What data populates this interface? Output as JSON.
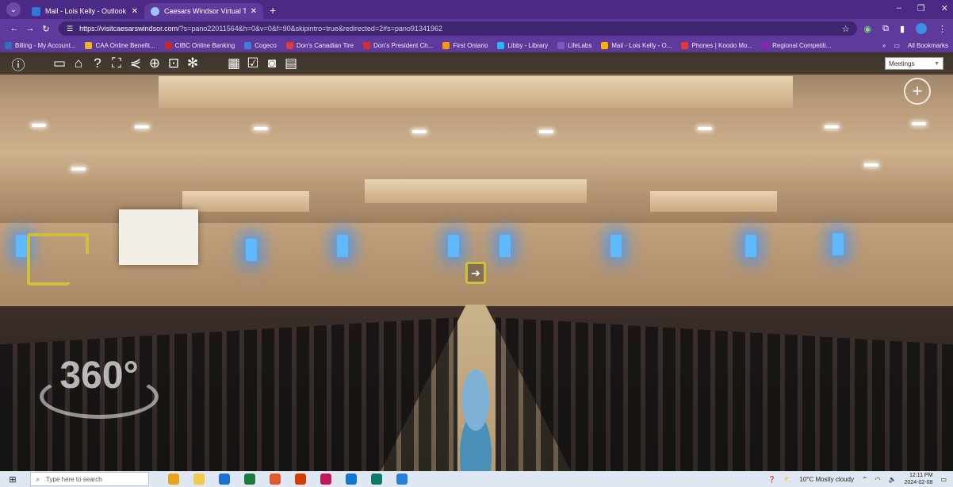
{
  "tabs": [
    {
      "title": "Mail - Lois Kelly - Outlook",
      "color": "#2b7bd8",
      "active": false
    },
    {
      "title": "Caesars Windsor Virtual Tour b",
      "color": "#9cc3f5",
      "active": true
    }
  ],
  "new_tab_symbol": "+",
  "window_controls": {
    "minimize": "–",
    "restore": "❐",
    "close": "✕"
  },
  "address_bar": {
    "domain": "https://visitcaesarswindsor.com",
    "path": "/?s=pano22011564&h=0&v=0&f=90&skipintro=true&redirected=2#s=pano91341962"
  },
  "bookmarks": [
    {
      "label": "Billing - My Account...",
      "color": "#2f6fc2"
    },
    {
      "label": "CAA Online Benefit...",
      "color": "#f0b429"
    },
    {
      "label": "CIBC Online Banking",
      "color": "#c62828"
    },
    {
      "label": "Cogeco",
      "color": "#3f7dd6"
    },
    {
      "label": "Don's Canadian Tire",
      "color": "#e53935"
    },
    {
      "label": "Don's President Ch...",
      "color": "#d32f2f"
    },
    {
      "label": "First Ontario",
      "color": "#ff9800"
    },
    {
      "label": "Libby - Library",
      "color": "#29b6f6"
    },
    {
      "label": "LifeLabs",
      "color": "#7e57c2"
    },
    {
      "label": "Mail - Lois Kelly - O...",
      "color": "#ffb300"
    },
    {
      "label": "Phones | Koodo Mo...",
      "color": "#e53935"
    },
    {
      "label": "Regional Competiti...",
      "color": "#8e24aa"
    }
  ],
  "bookmarks_overflow": "»",
  "all_bookmarks_label": "All Bookmarks",
  "viewer": {
    "dropdown_selected": "Meetings",
    "plus_symbol": "+",
    "badge_text": "360°",
    "hotspot_arrow": "➔"
  },
  "taskbar": {
    "search_placeholder": "Type here to search",
    "weather": "10°C  Mostly cloudy",
    "time": "12:11 PM",
    "date": "2024-02-08",
    "apps": [
      "#e8a317",
      "#f2c94c",
      "#1f6fd1",
      "#1e7b3e",
      "#e05a2a",
      "#d83b01",
      "#c2185b",
      "#0f77d4",
      "#117a65",
      "#2a7fd6"
    ]
  }
}
